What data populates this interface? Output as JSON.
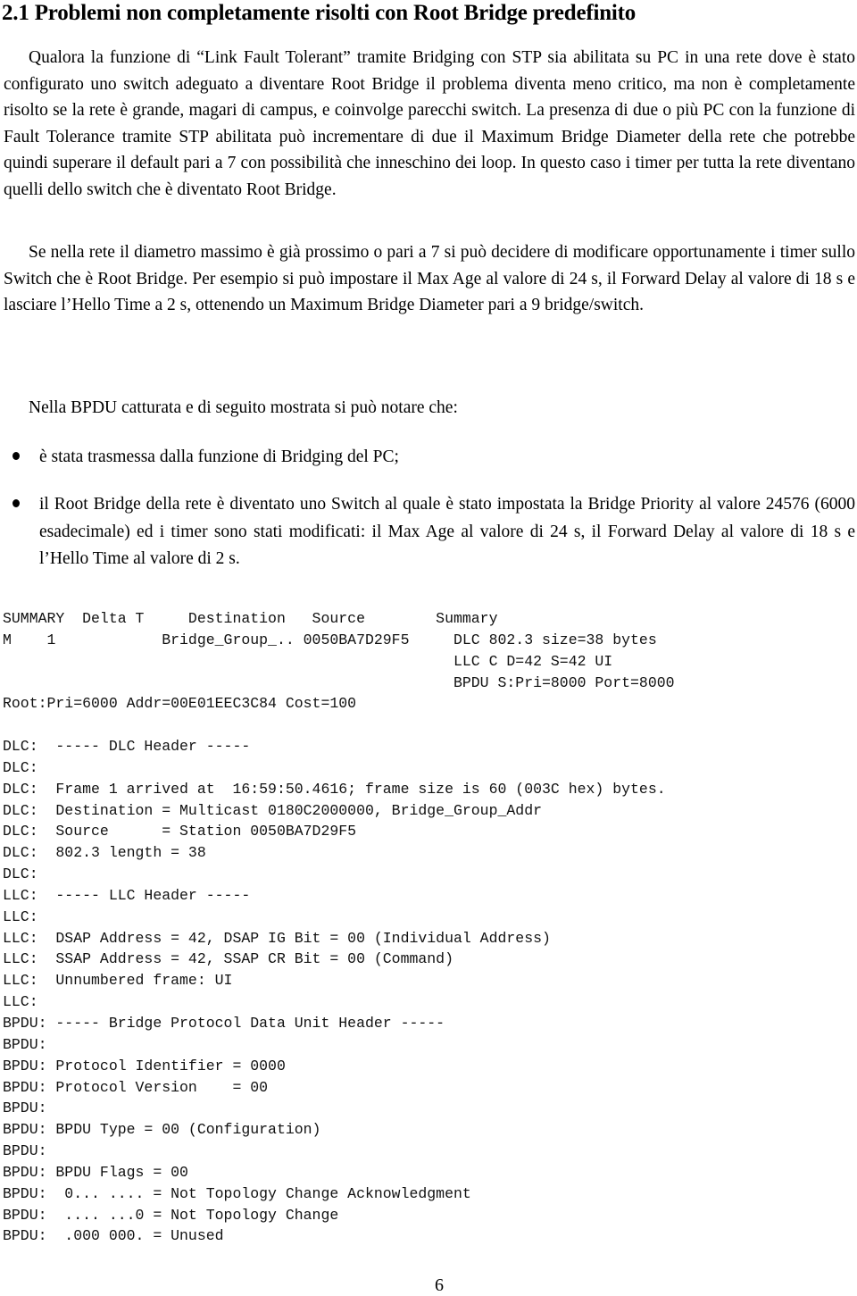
{
  "section": {
    "title": "2.1  Problemi non completamente risolti con Root Bridge predefinito"
  },
  "paragraphs": [
    "Qualora la funzione di “Link Fault Tolerant” tramite Bridging con STP sia abilitata su PC in una rete dove è stato configurato uno switch adeguato a diventare Root Bridge il problema diventa meno critico, ma non è completamente risolto se la rete è grande, magari di campus, e coinvolge parecchi switch. La presenza di due o più PC con la funzione di Fault Tolerance tramite STP abilitata può incrementare di due il Maximum Bridge Diameter della rete che potrebbe quindi superare il default pari a 7 con possibilità che inneschino dei loop. In questo caso i timer per tutta la rete diventano quelli dello switch che è diventato Root Bridge.",
    "Se nella rete il diametro massimo è già prossimo o pari a 7 si può decidere di modificare opportunamente i timer sullo Switch che è Root Bridge. Per esempio si può impostare il Max Age al valore di 24 s, il Forward Delay al valore di 18 s e lasciare l’Hello Time a 2 s, ottenendo un Maximum Bridge Diameter pari a 9 bridge/switch.",
    "Nella BPDU catturata e di seguito mostrata si può notare che:"
  ],
  "bullets": [
    "è stata trasmessa dalla funzione di Bridging del PC;",
    "il Root Bridge della rete è diventato uno Switch al quale è stato impostata la Bridge Priority al valore 24576 (6000 esadecimale) ed i timer sono stati modificati: il Max Age al valore di 24 s, il Forward Delay al valore di 18 s e l’Hello Time al valore di 2 s."
  ],
  "capture_summary": [
    "SUMMARY  Delta T     Destination   Source        Summary",
    "M    1            Bridge_Group_.. 0050BA7D29F5     DLC 802.3 size=38 bytes",
    "                                                   LLC C D=42 S=42 UI",
    "                                                   BPDU S:Pri=8000 Port=8000",
    "Root:Pri=6000 Addr=00E01EEC3C84 Cost=100"
  ],
  "capture_detail": [
    "DLC:  ----- DLC Header -----",
    "DLC:",
    "DLC:  Frame 1 arrived at  16:59:50.4616; frame size is 60 (003C hex) bytes.",
    "DLC:  Destination = Multicast 0180C2000000, Bridge_Group_Addr",
    "DLC:  Source      = Station 0050BA7D29F5",
    "DLC:  802.3 length = 38",
    "DLC:",
    "LLC:  ----- LLC Header -----",
    "LLC:",
    "LLC:  DSAP Address = 42, DSAP IG Bit = 00 (Individual Address)",
    "LLC:  SSAP Address = 42, SSAP CR Bit = 00 (Command)",
    "LLC:  Unnumbered frame: UI",
    "LLC:",
    "BPDU: ----- Bridge Protocol Data Unit Header -----",
    "BPDU:",
    "BPDU: Protocol Identifier = 0000",
    "BPDU: Protocol Version    = 00",
    "BPDU:",
    "BPDU: BPDU Type = 00 (Configuration)",
    "BPDU:",
    "BPDU: BPDU Flags = 00",
    "BPDU:  0... .... = Not Topology Change Acknowledgment",
    "BPDU:  .... ...0 = Not Topology Change",
    "BPDU:  .000 000. = Unused"
  ],
  "footer": {
    "page_number": "6"
  }
}
